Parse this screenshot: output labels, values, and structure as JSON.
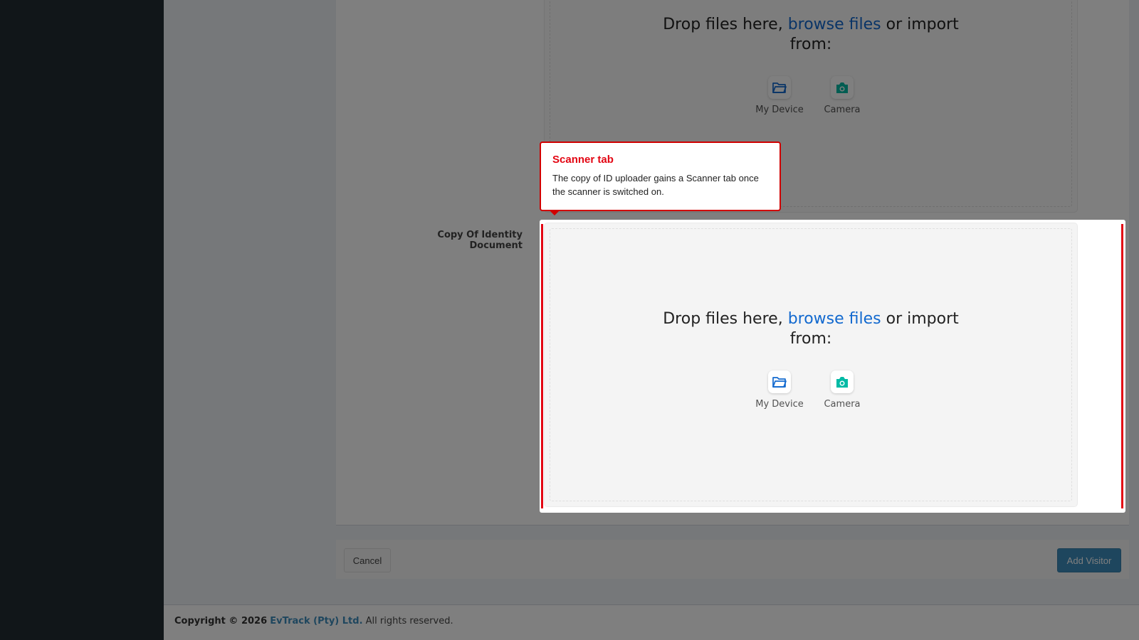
{
  "uploaders": [
    {
      "drop_text": "Drop files here,",
      "browse_text": "browse files",
      "after_text": "or import from:",
      "sources": [
        {
          "label": "My Device",
          "icon": "folder-icon",
          "color": "#1269cf"
        },
        {
          "label": "Camera",
          "icon": "camera-icon",
          "color": "#02baa5"
        }
      ]
    },
    {
      "field_label": "Copy Of Identity Document",
      "drop_text": "Drop files here,",
      "browse_text": "browse files",
      "after_text": "or import from:",
      "sources": [
        {
          "label": "My Device",
          "icon": "folder-icon",
          "color": "#1269cf"
        },
        {
          "label": "Camera",
          "icon": "camera-icon",
          "color": "#02baa5"
        }
      ]
    }
  ],
  "form_actions": {
    "cancel_label": "Cancel",
    "submit_label": "Add Visitor"
  },
  "footer": {
    "copyright": "Copyright © 2026",
    "company": "EvTrack (Pty) Ltd.",
    "rights": "All rights reserved."
  },
  "tooltip": {
    "title": "Scanner tab",
    "body": "The copy of ID uploader gains a Scanner tab once the scanner is switched on."
  },
  "colors": {
    "sidebar": "#222d32",
    "accent": "#3c8dbc",
    "browse_link": "#1269cf",
    "highlight": "#e30613"
  }
}
